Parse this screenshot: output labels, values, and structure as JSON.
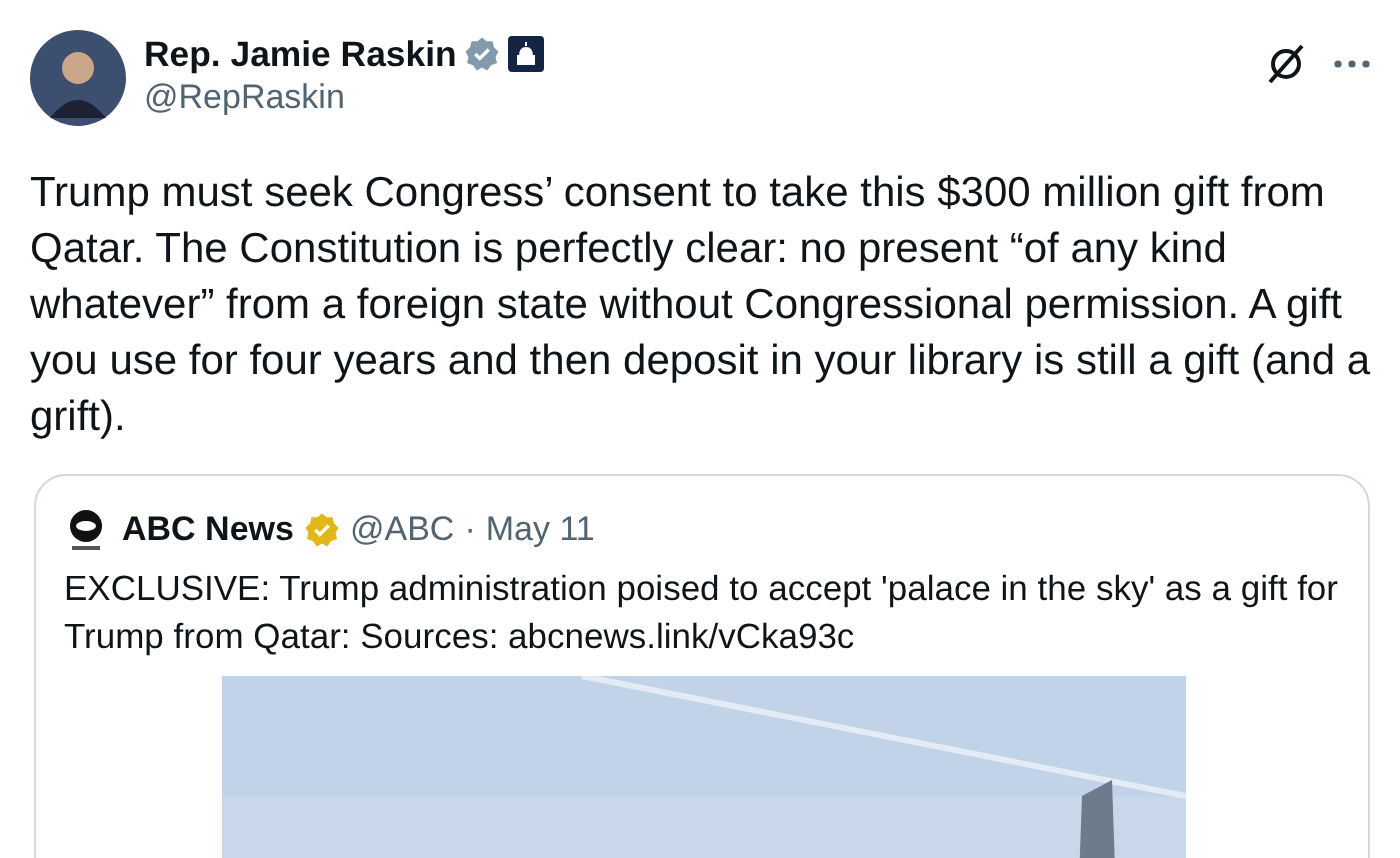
{
  "author": {
    "name": "Rep. Jamie Raskin",
    "handle": "@RepRaskin",
    "verified": true
  },
  "tweet_text": "Trump must seek Congress’ consent to take this $300 million gift from Qatar. The Constitution is perfectly clear: no present “of any kind whatever” from a foreign state without Congressional permission. A gift you use for four years and then deposit in your library is still a gift (and a grift).",
  "quoted_tweet": {
    "name": "ABC News",
    "handle": "@ABC",
    "separator": "·",
    "date": "May 11",
    "verified": true,
    "text": "EXCLUSIVE: Trump administration poised to accept 'palace in the sky' as a gift for Trump from Qatar: Sources: abcnews.link/vCka93c"
  }
}
